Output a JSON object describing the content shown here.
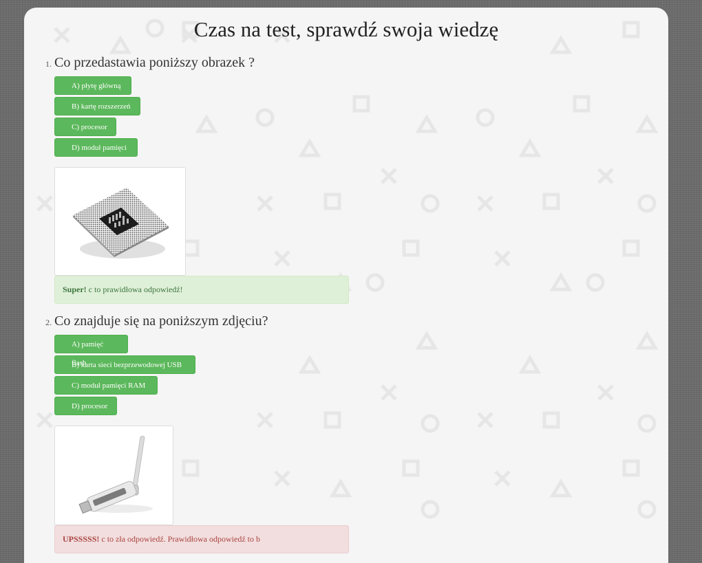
{
  "page": {
    "title": "Czas na test, sprawdź swoja wiedzę"
  },
  "questions": [
    {
      "number": "1.",
      "text": "Co przedastawia poniższy obrazek ?",
      "answers": [
        "A) płytę główną",
        "B) kartę rozszerzeń",
        "C) procesor",
        "D) moduł pamięci"
      ],
      "image_icon": "cpu-chip-icon",
      "feedback": {
        "type": "success",
        "strong": "Super!",
        "text": " c to prawidłowa odpowiedź!"
      }
    },
    {
      "number": "2.",
      "text": "Co znajduje się na poniższym zdjęciu?",
      "answers": [
        "A) pamięć flash",
        "B) karta sieci bezprzewodowej USB",
        "C) moduł pamięci RAM",
        "D) procesor"
      ],
      "image_icon": "usb-wifi-adapter-icon",
      "feedback": {
        "type": "danger",
        "strong": "UPSSSSS!",
        "text": " c to zła odpowiedź. Prawidłowa odpowiedź to b"
      }
    }
  ],
  "colors": {
    "answer_button": "#5cb85c",
    "success_bg": "#dff0d8",
    "danger_bg": "#f2dede",
    "panel_bg": "#f5f5f5"
  }
}
